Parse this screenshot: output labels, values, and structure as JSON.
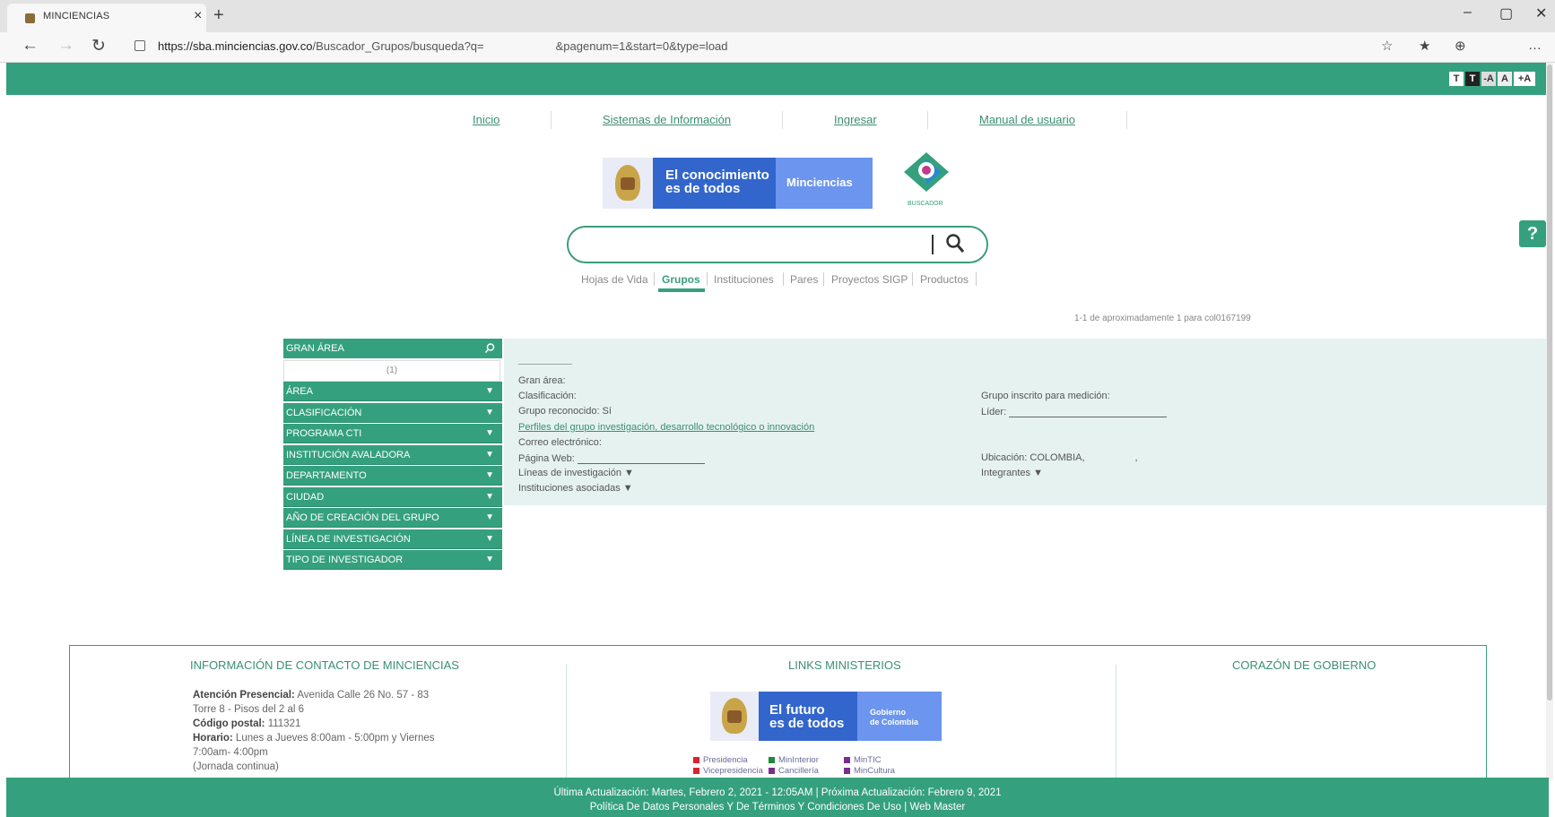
{
  "browser": {
    "tab_title": "MINCIENCIAS",
    "tab_close": "×",
    "new_tab": "+",
    "url_host": "https://sba.minciencias.gov.co",
    "url_path": "/Buscador_Grupos/busqueda?q=",
    "url_query": "&pagenum=1&start=0&type=load",
    "window_controls": [
      "–",
      "▢",
      "✕"
    ]
  },
  "text_size": {
    "buttons": [
      "T",
      "T",
      "-A",
      "A",
      "+A"
    ]
  },
  "nav": {
    "items": [
      "Inicio",
      "Sistemas de Información",
      "Ingresar",
      "Manual de usuario"
    ]
  },
  "logo": {
    "line1": "El conocimiento",
    "line2": "es de todos",
    "brand": "Minciencias",
    "buscador": "BUSCADOR"
  },
  "search": {
    "value": "",
    "placeholder": ""
  },
  "search_tabs": [
    "Hojas de Vida",
    "Grupos",
    "Instituciones",
    "Pares",
    "Proyectos SIGP",
    "Productos"
  ],
  "results_summary": "1-1 de aproximadamente 1 para col0167199",
  "sidebar": {
    "head": "GRAN ÁREA",
    "count": "(1)",
    "filters": [
      "ÁREA",
      "CLASIFICACIÓN",
      "PROGRAMA CTI",
      "INSTITUCIÓN AVALADORA",
      "DEPARTAMENTO",
      "CIUDAD",
      "AÑO DE CREACIÓN DEL GRUPO",
      "LÍNEA DE INVESTIGACIÓN",
      "TIPO DE INVESTIGADOR"
    ],
    "arrow": "▼"
  },
  "result": {
    "gran_area": "Gran área:",
    "clasificacion": "Clasificación:",
    "reconocido": "Grupo reconocido: Sí",
    "perfiles": "Perfiles del grupo investigación, desarrollo tecnológico o innovación",
    "correo": "Correo electrónico:",
    "pagina": "Página Web:",
    "lineas": "Líneas de investigación ▼",
    "instituciones": "Instituciones asociadas ▼",
    "inscrito": "Grupo inscrito para medición:",
    "lider": "Líder:",
    "ubicacion": "Ubicación: COLOMBIA,",
    "ubicacion_sep": ",",
    "integrantes": "Integrantes ▼"
  },
  "footer": {
    "contact_title": "INFORMACIÓN DE CONTACTO DE MINCIENCIAS",
    "contact_lines": [
      {
        "bold": "Atención Presencial:",
        "text": " Avenida Calle 26 No. 57 - 83"
      },
      {
        "bold": "",
        "text": "Torre 8 - Pisos del 2 al 6"
      },
      {
        "bold": "Código postal:",
        "text": " 111321"
      },
      {
        "bold": "Horario:",
        "text": " Lunes a Jueves 8:00am - 5:00pm y Viernes"
      },
      {
        "bold": "",
        "text": "7:00am- 4:00pm"
      },
      {
        "bold": "",
        "text": "(Jornada continua)"
      }
    ],
    "links_title": "LINKS MINISTERIOS",
    "futuro_line1": "El futuro",
    "futuro_line2": "es de todos",
    "gobierno_line1": "Gobierno",
    "gobierno_line2": "de Colombia",
    "ministry_links": [
      {
        "label": "Presidencia",
        "color": "#d9232e"
      },
      {
        "label": "MinInterior",
        "color": "#1f8a3b"
      },
      {
        "label": "MinTIC",
        "color": "#7b2c8f"
      },
      {
        "label": "Vicepresidencia",
        "color": "#d9232e"
      },
      {
        "label": "Cancillería",
        "color": "#7b2c8f"
      },
      {
        "label": "MinCultura",
        "color": "#7b2c8f"
      }
    ],
    "corazon_title": "CORAZÓN DE GOBIERNO"
  },
  "bottom": {
    "update": "Última Actualización: Martes, Febrero 2, 2021 - 12:05AM | Próxima Actualización: Febrero 9, 2021",
    "legal": "Política De Datos Personales Y De Términos Y Condiciones De Uso | Web Master"
  },
  "help": "?",
  "colors": {
    "brand_green": "#35a07d",
    "panel": "#e5f2ef",
    "gov_blue": "#3366cc"
  }
}
